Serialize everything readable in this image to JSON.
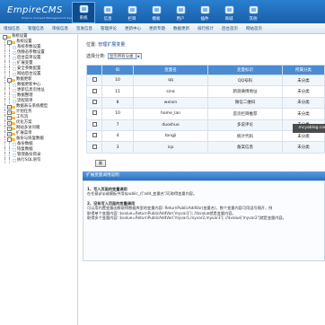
{
  "app": {
    "logo": "EmpireCMS",
    "logo_sub": "Empire Content Management System"
  },
  "topnav": [
    {
      "label": "系统",
      "icon": "home-icon",
      "active": true
    },
    {
      "label": "信息",
      "icon": "info-icon",
      "active": false
    },
    {
      "label": "栏目",
      "icon": "column-icon",
      "active": false
    },
    {
      "label": "模板",
      "icon": "template-icon",
      "active": false
    },
    {
      "label": "用户",
      "icon": "user-icon",
      "active": false
    },
    {
      "label": "插件",
      "icon": "plugin-icon",
      "active": false
    },
    {
      "label": "商城",
      "icon": "shop-icon",
      "active": false
    },
    {
      "label": "其他",
      "icon": "other-icon",
      "active": false
    }
  ],
  "subnav": [
    "增加信息",
    "管理信息",
    "审核信息",
    "签发信息",
    "管理评论",
    "更新中心",
    "更新专题",
    "数据更新",
    "排行统计",
    "后台首页",
    "网站首页"
  ],
  "sidebar": [
    {
      "label": "系统设置",
      "indent": 0,
      "box": "-"
    },
    {
      "label": "系统设置",
      "indent": 1,
      "box": "-"
    },
    {
      "label": "系统参数设置",
      "indent": 2
    },
    {
      "label": "伪静态参数设置",
      "indent": 2
    },
    {
      "label": "后台菜单设置",
      "indent": 2
    },
    {
      "label": "扩展变量",
      "indent": 2
    },
    {
      "label": "安全参数配置",
      "indent": 2
    },
    {
      "label": "网站后台设置",
      "indent": 2
    },
    {
      "label": "数据更新",
      "indent": 1,
      "box": "-"
    },
    {
      "label": "数据更新中心",
      "indent": 2
    },
    {
      "label": "更新信息页地址",
      "indent": 2
    },
    {
      "label": "数据整理",
      "indent": 2
    },
    {
      "label": "流程简单",
      "indent": 2
    },
    {
      "label": "数据表与系统模型",
      "indent": 1,
      "box": "+"
    },
    {
      "label": "计划任务",
      "indent": 1,
      "box": "+"
    },
    {
      "label": "工作流",
      "indent": 1,
      "box": "+"
    },
    {
      "label": "优化方案",
      "indent": 1,
      "box": "+"
    },
    {
      "label": "网站多访问端",
      "indent": 1,
      "box": "+"
    },
    {
      "label": "扩展菜单",
      "indent": 1,
      "box": "+"
    },
    {
      "label": "备份与恢复数据",
      "indent": 1,
      "box": "-"
    },
    {
      "label": "备份数据",
      "indent": 2
    },
    {
      "label": "恢复数据",
      "indent": 2
    },
    {
      "label": "管理备份目录",
      "indent": 2
    },
    {
      "label": "执行SQL语句",
      "indent": 2
    }
  ],
  "main": {
    "crumb_prefix": "位置:",
    "crumb_link": "管理扩展变量",
    "filter_label": "选择分类:",
    "filter_value": "显示所有分类",
    "columns": [
      "ID",
      "变量名",
      "变量标识",
      "所属分类"
    ],
    "rows": [
      {
        "id": "10",
        "name": "qq",
        "desc": "QQ号码",
        "cat": "未分类"
      },
      {
        "id": "11",
        "name": "sina",
        "desc": "新浪微博地址",
        "cat": "未分类"
      },
      {
        "id": "8",
        "name": "weixin",
        "desc": "微信二维码",
        "cat": "未分类"
      },
      {
        "id": "10",
        "name": "home_lan",
        "desc": "首页栏目推荐",
        "cat": "未分类"
      },
      {
        "id": "7",
        "name": "duoshuo",
        "desc": "多说评论",
        "cat": "未分类"
      },
      {
        "id": "4",
        "name": "tongji",
        "desc": "统计代码",
        "cat": "未分类"
      },
      {
        "id": "3",
        "name": "icp",
        "desc": "备案信息",
        "cat": "未分类"
      }
    ],
    "submit_label": "删",
    "info_title": "扩展变量调用说明",
    "info_lines": [
      {
        "text": "1、写入页面的变量调用",
        "bold": true
      },
      {
        "text": "在任意php或模板中用$public_r['add_变量名']可取得变量内容。",
        "bold": false
      },
      {
        "text": "",
        "bold": false
      },
      {
        "text": "2、没有写入页面的变量调用",
        "bold": true
      },
      {
        "text": "可以用内置变量函数取得数据库里的变量内容: ReturnPublicAddVar(变量名)，数个变量内容可用逗号隔开，例",
        "bold": false
      },
      {
        "text": "取得单个变量内容: $value=ReturnPublicAddVar('myvar1'); //$value就是变量内容。",
        "bold": false
      },
      {
        "text": "取得多个变量内容: $value=ReturnPublicAddVar('myvar1,myvar2,myvar3'); //$value['myvar2']就是变量内容。",
        "bold": false
      }
    ],
    "watermark": "mcyablog.com"
  }
}
